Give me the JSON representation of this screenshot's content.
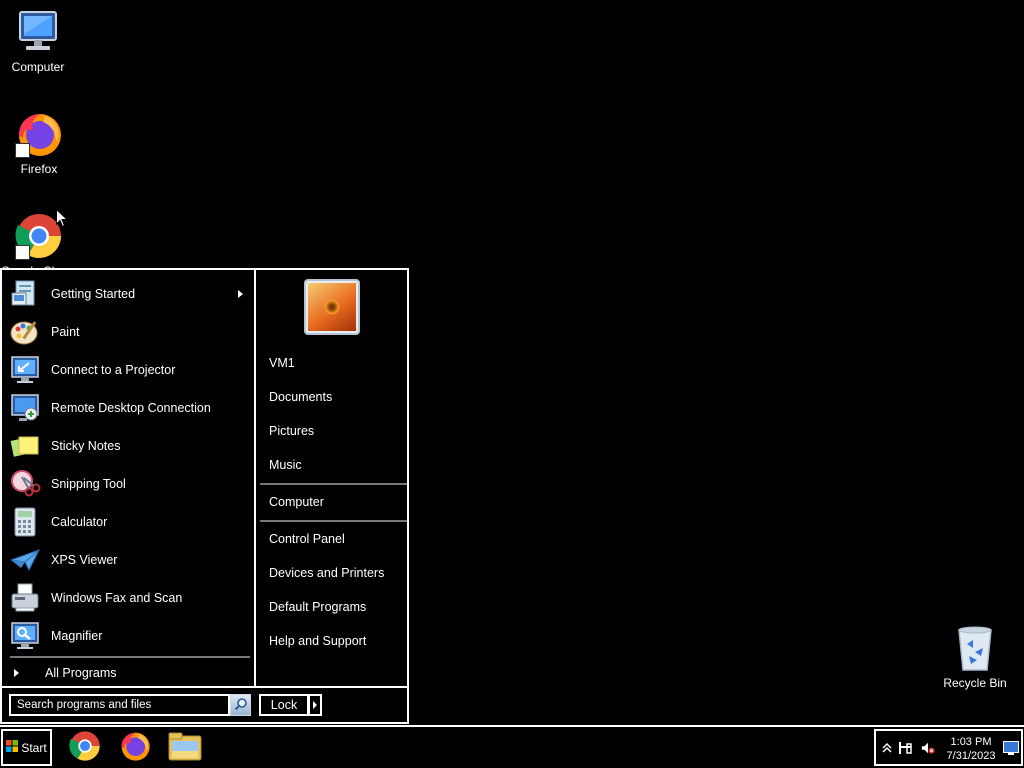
{
  "desktop": {
    "icons": [
      {
        "label": "Computer"
      },
      {
        "label": "Firefox"
      },
      {
        "label": "Google Chrome"
      },
      {
        "label": "Recycle Bin"
      }
    ]
  },
  "start_menu": {
    "programs": [
      {
        "label": "Getting Started",
        "icon": "getting-started-icon",
        "has_submenu": true
      },
      {
        "label": "Paint",
        "icon": "paint-icon"
      },
      {
        "label": "Connect to a Projector",
        "icon": "projector-icon"
      },
      {
        "label": "Remote Desktop Connection",
        "icon": "remote-desktop-icon"
      },
      {
        "label": "Sticky Notes",
        "icon": "sticky-notes-icon"
      },
      {
        "label": "Snipping Tool",
        "icon": "snipping-tool-icon"
      },
      {
        "label": "Calculator",
        "icon": "calculator-icon"
      },
      {
        "label": "XPS Viewer",
        "icon": "xps-viewer-icon"
      },
      {
        "label": "Windows Fax and Scan",
        "icon": "fax-scan-icon"
      },
      {
        "label": "Magnifier",
        "icon": "magnifier-icon"
      }
    ],
    "all_programs": "All Programs",
    "search_placeholder": "Search programs and files",
    "right": {
      "user": "VM1",
      "documents": "Documents",
      "pictures": "Pictures",
      "music": "Music",
      "computer": "Computer",
      "control_panel": "Control Panel",
      "devices_printers": "Devices and Printers",
      "default_programs": "Default Programs",
      "help_support": "Help and Support"
    },
    "lock": "Lock"
  },
  "taskbar": {
    "start": "Start",
    "pinned": [
      "chrome-icon",
      "firefox-icon",
      "file-explorer-icon"
    ],
    "clock": {
      "time": "1:03 PM",
      "date": "7/31/2023"
    }
  },
  "colors": {
    "background": "#000000",
    "foreground": "#ffffff",
    "separator": "#777777"
  }
}
